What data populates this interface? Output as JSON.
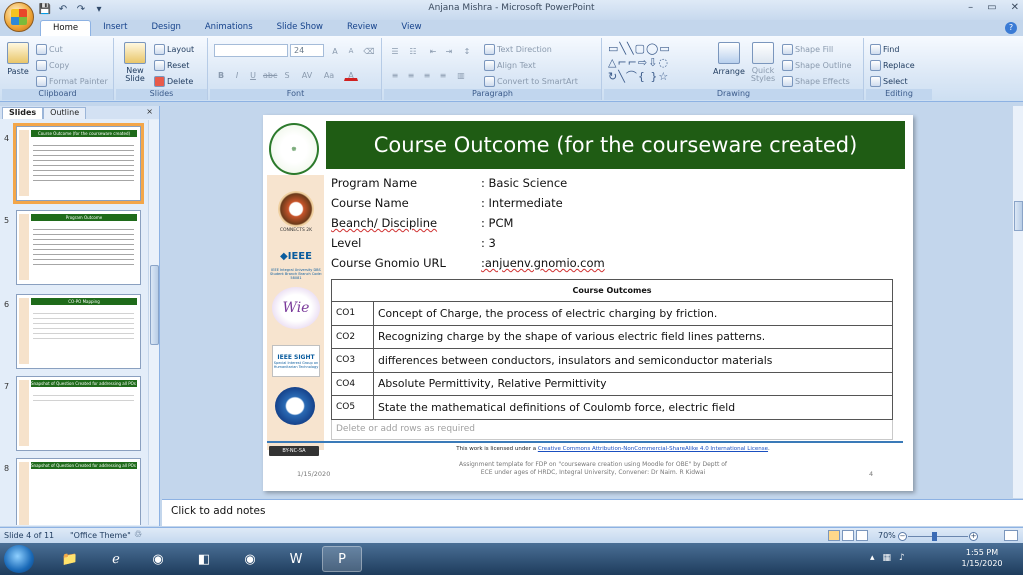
{
  "window": {
    "title": "Anjana Mishra - Microsoft PowerPoint",
    "controls": [
      "–",
      "▭",
      "✕"
    ]
  },
  "quick_access": [
    "💾",
    "↶",
    "↷",
    "▾"
  ],
  "tabs": [
    "Home",
    "Insert",
    "Design",
    "Animations",
    "Slide Show",
    "Review",
    "View"
  ],
  "ribbon": {
    "clipboard": {
      "label": "Clipboard",
      "paste": "Paste",
      "cut": "Cut",
      "copy": "Copy",
      "format_painter": "Format Painter"
    },
    "slides": {
      "label": "Slides",
      "new_slide": "New Slide",
      "layout": "Layout",
      "reset": "Reset",
      "delete": "Delete"
    },
    "font": {
      "label": "Font",
      "font_name": "",
      "font_size": "24",
      "bold": "B",
      "italic": "I",
      "underline": "U",
      "strike": "abc",
      "shadow": "S",
      "spacing": "AV",
      "case": "Aa",
      "color": "A",
      "grow": "A",
      "shrink": "A"
    },
    "paragraph": {
      "label": "Paragraph",
      "text_direction": "Text Direction",
      "align_text": "Align Text",
      "convert_smartart": "Convert to SmartArt"
    },
    "drawing": {
      "label": "Drawing",
      "arrange": "Arrange",
      "quick_styles": "Quick Styles",
      "shape_fill": "Shape Fill",
      "shape_outline": "Shape Outline",
      "shape_effects": "Shape Effects"
    },
    "editing": {
      "label": "Editing",
      "find": "Find",
      "replace": "Replace",
      "select": "Select"
    }
  },
  "panel": {
    "tabs": [
      "Slides",
      "Outline"
    ],
    "close": "×",
    "thumbnails": [
      {
        "num": "4",
        "title": "Course Outcome (for the courseware created)",
        "selected": true
      },
      {
        "num": "5",
        "title": "Program Outcome",
        "selected": false
      },
      {
        "num": "6",
        "title": "CO-PO Mapping",
        "selected": false
      },
      {
        "num": "7",
        "title": "Snapshot of Question Created for addressing all POs with CO-PO-BT Mapping",
        "selected": false
      },
      {
        "num": "8",
        "title": "Snapshot of Question Created for addressing all POs with CO-PO-BT Mapping",
        "selected": false
      }
    ]
  },
  "slide": {
    "title": "Course Outcome (for the courseware created)",
    "info": [
      {
        "label": "Program Name",
        "value": ": Basic Science"
      },
      {
        "label": "Course Name",
        "value": ": Intermediate"
      },
      {
        "label": "Beanch/ Discipline",
        "value": ": PCM"
      },
      {
        "label": "Level",
        "value": ": 3"
      },
      {
        "label": "Course Gnomio URL",
        "value": ":anjuenv.gnomio.com"
      }
    ],
    "table_header": "Course Outcomes",
    "outcomes": [
      {
        "code": "CO1",
        "text": "Concept of Charge, the process of electric charging by friction."
      },
      {
        "code": "CO2",
        "text": "Recognizing charge by the shape of various electric field lines patterns."
      },
      {
        "code": "CO3",
        "text": "differences between conductors, insulators and semiconductor materials"
      },
      {
        "code": "CO4",
        "text": "Absolute Permittivity,  Relative Permittivity"
      },
      {
        "code": "CO5",
        "text": "State the mathematical definitions of Coulomb force, electric field"
      }
    ],
    "add_rows_placeholder": "Delete or add rows as required",
    "license_prefix": "This work is licensed under a ",
    "license_link": "Creative Commons Attribution-NonCommercial-ShareAlike 4.0 International License",
    "license_suffix": ".",
    "cc_badge": "BY-NC-SA",
    "date": "1/15/2020",
    "footer_text": "Assignment template for FDP on \"courseware creation using Moodle for OBE\"  by Deptt of ECE under ages of HRDC, Integral University,  Convener: Dr Naim. R Kidwai",
    "page_number": "4",
    "logos": {
      "seal_caption": "CONNECTS 2K",
      "ieee": "◆IEEE",
      "ieee_caption": "IEEE Integral University DBS Student Branch Branch Code: 58081",
      "wie": "Wie",
      "sight_top": "IEEE SIGHT",
      "sight_caption": "Special Interest Group on Humanitarian Technology"
    }
  },
  "notes_placeholder": "Click to add notes",
  "status": {
    "slide_info": "Slide 4 of 11",
    "theme": "\"Office Theme\"",
    "zoom": "70%"
  },
  "taskbar": {
    "time": "1:55 PM",
    "date": "1/15/2020"
  },
  "colors": {
    "title_bar": "#1f5c14",
    "side_strip": "#f7e4cf",
    "selected_thumb": "#f3a649"
  }
}
